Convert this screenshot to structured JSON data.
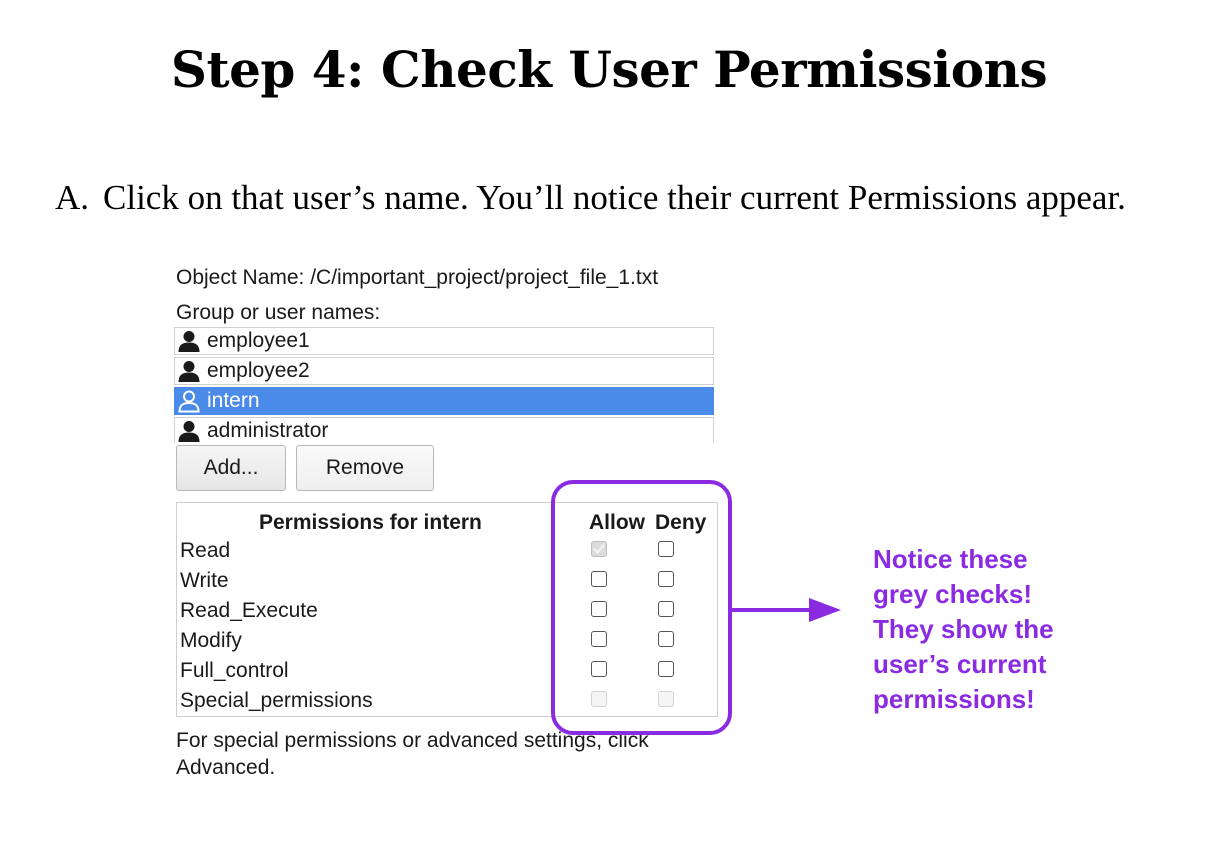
{
  "page": {
    "title": "Step 4: Check User Permissions",
    "instruction_letter": "A.",
    "instruction_text": "Click on that user’s name. You’ll notice their current Permissions appear."
  },
  "dialog": {
    "object_name": "Object Name: /C/important_project/project_file_1.txt",
    "group_label": "Group or user names:",
    "users": [
      {
        "name": "employee1",
        "selected": false
      },
      {
        "name": "employee2",
        "selected": false
      },
      {
        "name": "intern",
        "selected": true
      },
      {
        "name": "administrator",
        "selected": false
      }
    ],
    "add_button": "Add...",
    "remove_button": "Remove",
    "permissions_title": "Permissions for intern",
    "allow_header": "Allow",
    "deny_header": "Deny",
    "permissions": [
      {
        "name": "Read",
        "allow": "grey-checked",
        "deny": "unchecked"
      },
      {
        "name": "Write",
        "allow": "unchecked",
        "deny": "unchecked"
      },
      {
        "name": "Read_Execute",
        "allow": "unchecked",
        "deny": "unchecked"
      },
      {
        "name": "Modify",
        "allow": "unchecked",
        "deny": "unchecked"
      },
      {
        "name": "Full_control",
        "allow": "unchecked",
        "deny": "unchecked"
      },
      {
        "name": "Special_permissions",
        "allow": "disabled",
        "deny": "disabled"
      }
    ],
    "footer_note": "For special permissions or advanced settings, click Advanced."
  },
  "annotation": {
    "lines": [
      "Notice these",
      "grey checks!",
      "They show the",
      "user’s current",
      "permissions!"
    ],
    "color": "#8a2be2"
  },
  "colors": {
    "selection": "#4a8ae8",
    "accent": "#8a2be2"
  },
  "icons": {
    "user": "user-icon",
    "arrow": "arrow-right-icon"
  }
}
